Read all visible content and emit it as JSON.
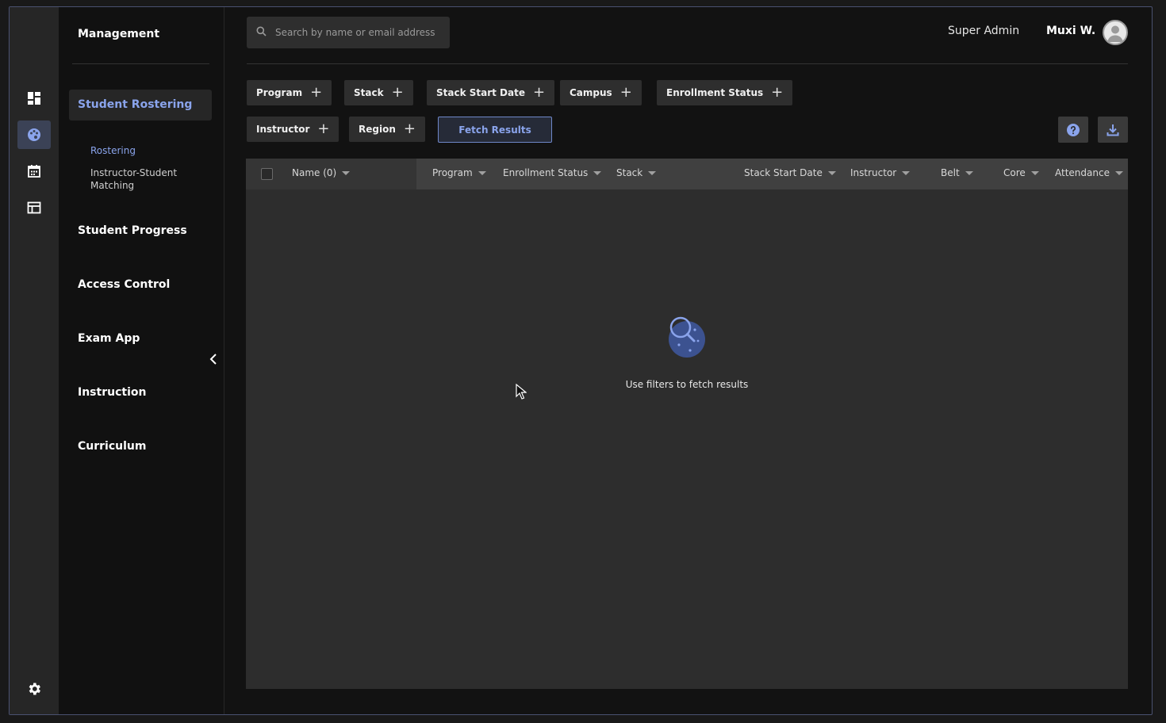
{
  "rail": {
    "icons": [
      "dashboard-icon",
      "palette-icon",
      "calendar-icon",
      "table-icon"
    ],
    "settings_icon": "gear-icon"
  },
  "nav": {
    "header": "Management",
    "active_section": "Student Rostering",
    "sub_items": [
      "Rostering",
      "Instructor-Student",
      "Matching"
    ],
    "items": [
      "Student Progress",
      "Access Control",
      "Exam App",
      "Instruction",
      "Curriculum"
    ]
  },
  "search": {
    "placeholder": "Search by name or email address",
    "value": ""
  },
  "header": {
    "role": "Super Admin",
    "user": "Muxi W."
  },
  "filters": [
    "Program",
    "Stack",
    "Stack Start Date",
    "Campus",
    "Enrollment Status",
    "Instructor",
    "Region"
  ],
  "fetch_label": "Fetch Results",
  "table": {
    "columns": [
      "Name (0)",
      "Program",
      "Enrollment Status",
      "Stack",
      "Stack Start Date",
      "Instructor",
      "Belt",
      "Core",
      "Attendance"
    ],
    "empty_message": "Use filters to fetch results"
  },
  "colors": {
    "accent": "#8aa4ec",
    "background": "#121212",
    "panel": "#2d2d2d"
  }
}
